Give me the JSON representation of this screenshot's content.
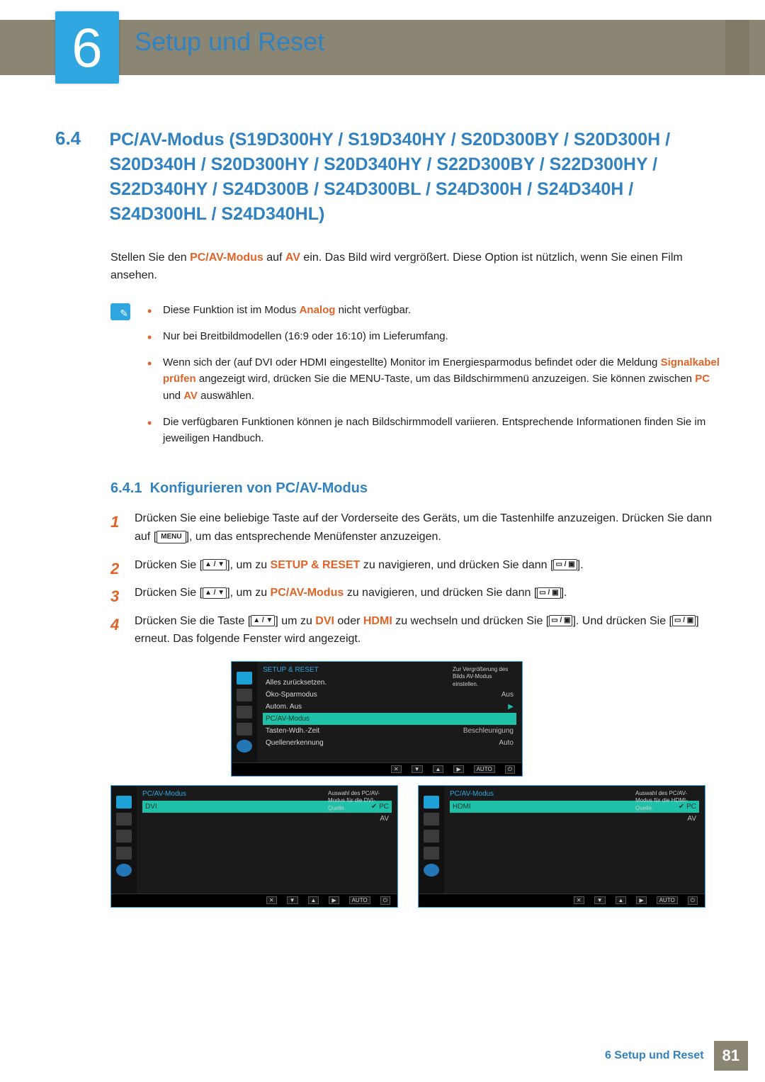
{
  "chapter": {
    "number": "6",
    "title": "Setup und Reset"
  },
  "section": {
    "number": "6.4",
    "title": "PC/AV-Modus (S19D300HY / S19D340HY / S20D300BY / S20D300H / S20D340H / S20D300HY / S20D340HY / S22D300BY / S22D300HY / S22D340HY / S24D300B / S24D300BL / S24D300H / S24D340H / S24D300HL / S24D340HL)"
  },
  "intro": {
    "pre": "Stellen Sie den ",
    "hl1": "PC/AV-Modus",
    "mid": " auf ",
    "hl2": "AV",
    "post": " ein. Das Bild wird vergrößert. Diese Option ist nützlich, wenn Sie einen Film ansehen."
  },
  "notes": {
    "b1": {
      "pre": "Diese Funktion ist im Modus ",
      "hl": "Analog",
      "post": " nicht verfügbar."
    },
    "b2": "Nur bei Breitbildmodellen (16:9 oder 16:10) im Lieferumfang.",
    "b3": {
      "pre": "Wenn sich der (auf DVI oder HDMI eingestellte) Monitor im Energiesparmodus befindet oder die Meldung ",
      "hl1": "Signalkabel prüfen",
      "mid": " angezeigt wird, drücken Sie die MENU-Taste, um das Bildschirmmenü anzuzeigen. Sie können zwischen ",
      "hl2": "PC",
      "mid2": " und ",
      "hl3": "AV",
      "post": " auswählen."
    },
    "b4": "Die verfügbaren Funktionen können je nach Bildschirmmodell variieren. Entsprechende Informationen finden Sie im jeweiligen Handbuch."
  },
  "subsection": {
    "number": "6.4.1",
    "title": "Konfigurieren von PC/AV-Modus"
  },
  "keys": {
    "menu": "MENU",
    "updown": "▲ / ▼",
    "select": "▭ / ▣",
    "auto": "AUTO",
    "down": "▼",
    "up": "▲",
    "right": "▶",
    "close": "✕",
    "power": "⏻"
  },
  "steps": {
    "s1a": "Drücken Sie eine beliebige Taste auf der Vorderseite des Geräts, um die Tastenhilfe anzuzeigen. Drücken Sie dann auf [",
    "s1b": "], um das entsprechende Menüfenster anzuzeigen.",
    "s2a": "Drücken Sie [",
    "s2b": "], um zu ",
    "s2hl": "SETUP & RESET",
    "s2c": " zu navigieren, und drücken Sie dann [",
    "s2d": "].",
    "s3a": "Drücken Sie [",
    "s3b": "], um zu ",
    "s3hl": "PC/AV-Modus",
    "s3c": " zu navigieren, und drücken Sie dann [",
    "s3d": "].",
    "s4a": "Drücken Sie die Taste [",
    "s4b": "] um zu ",
    "s4hl1": "DVI",
    "s4mid": " oder ",
    "s4hl2": "HDMI",
    "s4c": " zu wechseln und drücken Sie [",
    "s4d": "]. Und drücken Sie [",
    "s4e": "] erneut. Das folgende Fenster wird angezeigt."
  },
  "osd1": {
    "title": "SETUP & RESET",
    "rows": [
      {
        "label": "Alles zurücksetzen.",
        "val": ""
      },
      {
        "label": "Öko-Sparmodus",
        "val": "Aus"
      },
      {
        "label": "Autom. Aus",
        "val": "▶"
      },
      {
        "label": "PC/AV-Modus",
        "val": "▶",
        "sel": true
      },
      {
        "label": "Tasten-Wdh.-Zeit",
        "val": "Beschleunigung"
      },
      {
        "label": "Quellenerkennung",
        "val": "Auto"
      }
    ],
    "hint": "Zur Vergrößerung des Bilds AV-Modus einstellen."
  },
  "osd2": {
    "title": "PC/AV-Modus",
    "source": "DVI",
    "opt1": "PC",
    "opt2": "AV",
    "hint": "Auswahl des PC/AV-Modus für die DVI-Quelle."
  },
  "osd3": {
    "title": "PC/AV-Modus",
    "source": "HDMI",
    "opt1": "PC",
    "opt2": "AV",
    "hint": "Auswahl des PC/AV-Modus für die HDMI-Quelle."
  },
  "footer": {
    "label": "6 Setup und Reset",
    "page": "81"
  }
}
